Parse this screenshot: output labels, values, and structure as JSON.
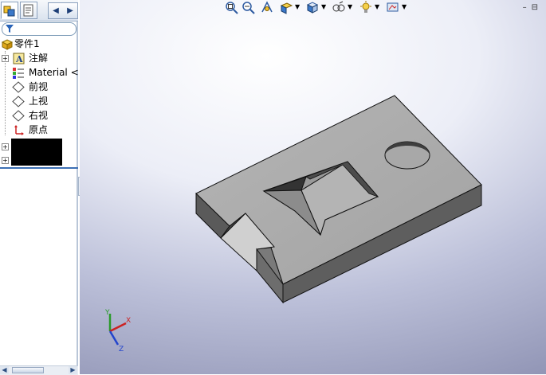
{
  "tree": {
    "root": "零件1",
    "items": [
      {
        "label": "注解",
        "icon": "annotation-a-icon",
        "expandable": true
      },
      {
        "label": "Material <not specified>",
        "icon": "material-icon",
        "expandable": false
      },
      {
        "label": "前视",
        "icon": "plane-icon",
        "expandable": false
      },
      {
        "label": "上视",
        "icon": "plane-icon",
        "expandable": false
      },
      {
        "label": "右视",
        "icon": "plane-icon",
        "expandable": false
      },
      {
        "label": "原点",
        "icon": "origin-icon",
        "expandable": false
      }
    ]
  },
  "triad": {
    "x": "X",
    "y": "Y",
    "z": "Z"
  },
  "colors": {
    "accent": "#3c6fb4",
    "model_face": "#a9a9a9"
  }
}
